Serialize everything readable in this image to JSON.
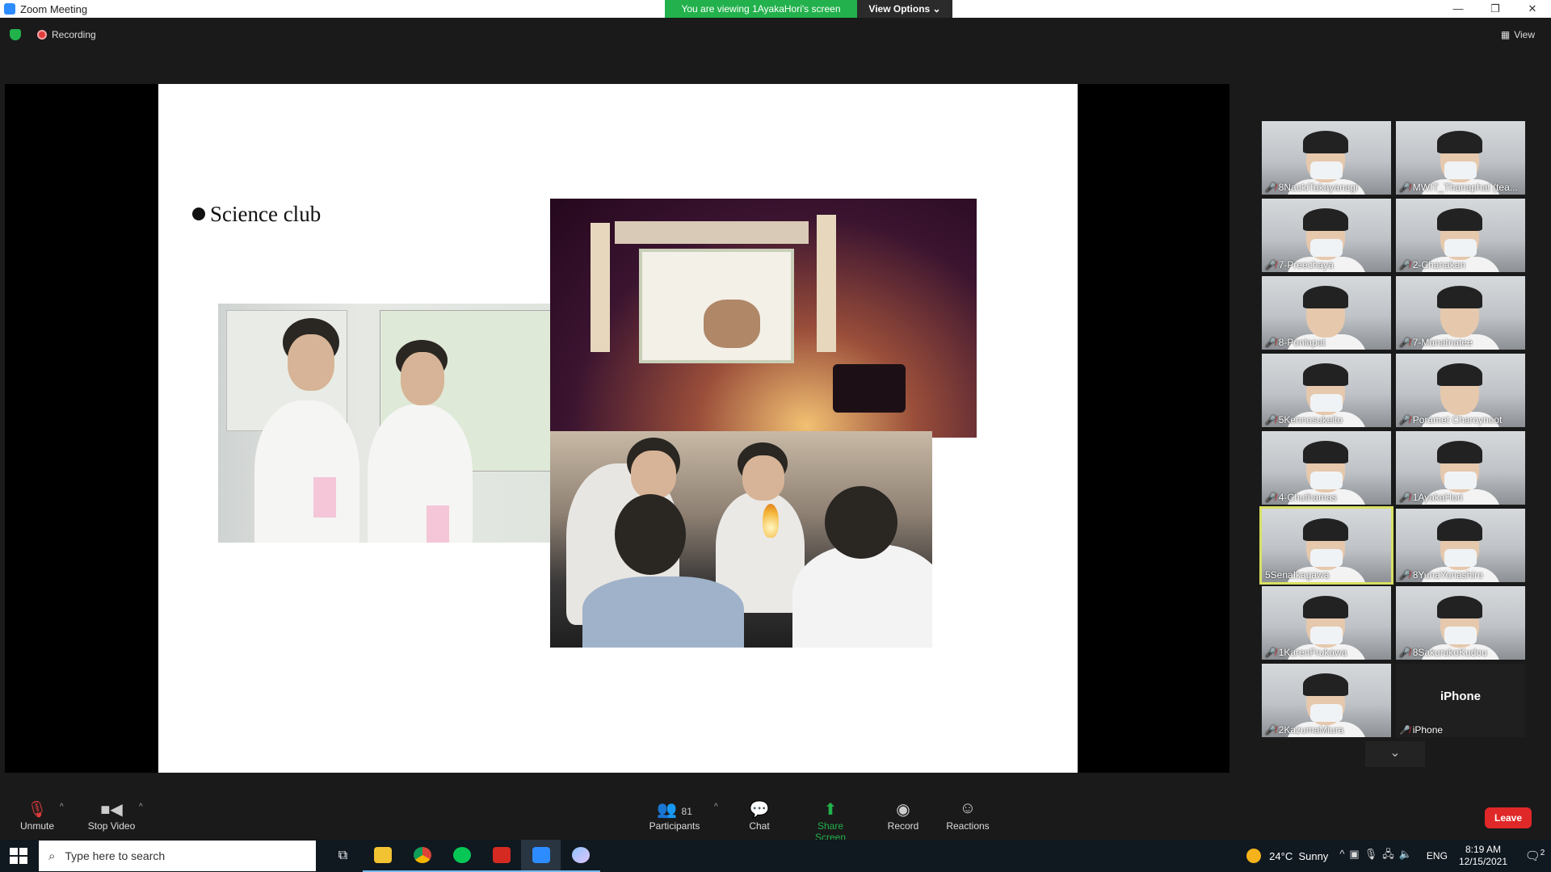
{
  "window": {
    "title": "Zoom Meeting",
    "viewing_banner": "You are viewing 1AyakaHori's screen",
    "view_options": "View Options ⌄",
    "controls": {
      "minimize": "—",
      "restore": "❐",
      "close": "✕"
    }
  },
  "status": {
    "recording_label": "Recording",
    "view_label": "View"
  },
  "slide": {
    "title": "Science club"
  },
  "participants": [
    {
      "name": "8NaokiTakayanagi"
    },
    {
      "name": "MWIT_Thanaphat (tea..."
    },
    {
      "name": "7-Preechaya"
    },
    {
      "name": "2-Chanakan"
    },
    {
      "name": "8-Ponlapat"
    },
    {
      "name": "7-Manatnatee"
    },
    {
      "name": "5Kennosukeito"
    },
    {
      "name": "Poramet Charoynoot"
    },
    {
      "name": "4-Chuthamas"
    },
    {
      "name": "1AyakaHori"
    },
    {
      "name": "5SenaIkagawa",
      "active": true
    },
    {
      "name": "8YunaYonashiro"
    },
    {
      "name": "1KarenFrukawa"
    },
    {
      "name": "8SakurakoKudou"
    },
    {
      "name": "2KazumaMiura"
    },
    {
      "name": "iPhone",
      "display": "iPhone"
    }
  ],
  "toolbar": {
    "unmute": "Unmute",
    "stop_video": "Stop Video",
    "participants": "Participants",
    "participants_count": "81",
    "chat": "Chat",
    "share_screen": "Share Screen",
    "record": "Record",
    "reactions": "Reactions",
    "leave": "Leave"
  },
  "taskbar": {
    "search_placeholder": "Type here to search",
    "temperature": "24°C",
    "weather": "Sunny",
    "language": "ENG",
    "time": "8:19 AM",
    "date": "12/15/2021",
    "notification_count": "2"
  },
  "colors": {
    "accent_green": "#22b14c",
    "leave_red": "#e02828",
    "active_speaker": "#d8e063"
  }
}
